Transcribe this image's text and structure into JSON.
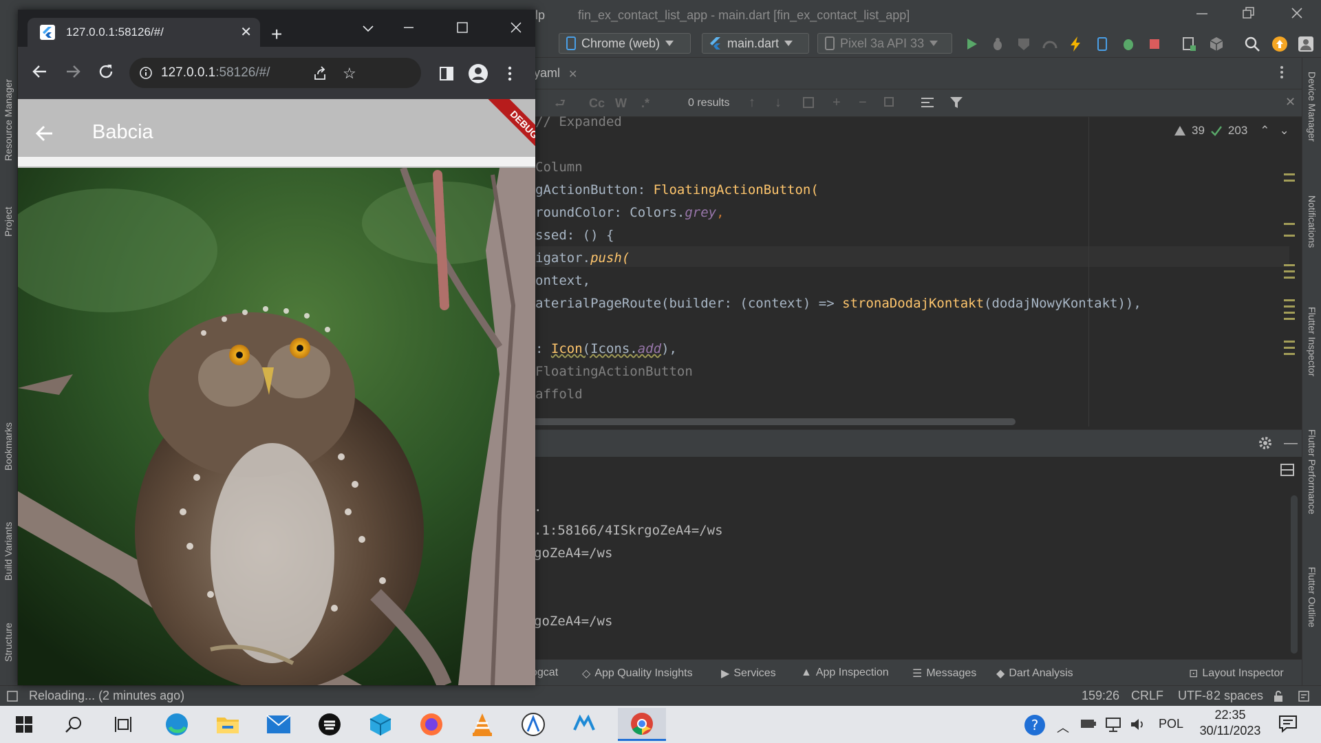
{
  "ide": {
    "title_fragment": "lp",
    "title": "fin_ex_contact_list_app - main.dart [fin_ex_contact_list_app]",
    "toolbar": {
      "device_target": "Chrome (web)",
      "run_config": "main.dart",
      "emulator": "Pixel 3a API 33"
    },
    "left_panels": [
      "Resource Manager",
      "Project",
      "Bookmarks",
      "Build Variants",
      "Structure"
    ],
    "right_panels": [
      "Device Manager",
      "Notifications",
      "Flutter Inspector",
      "Flutter Performance",
      "Flutter Outline"
    ],
    "editor_tab": "yaml",
    "find": {
      "case_label": "Cc",
      "word_label": "W",
      "regex_label": ".*",
      "results": "0 results"
    },
    "inspection": {
      "warnings": "39",
      "weak_warnings": "203"
    },
    "code": {
      "l1": "// Expanded",
      "l2": "Column",
      "l3a": "gActionButton: ",
      "l3b": "FloatingActionButton(",
      "l4a": "roundColor: Colors.",
      "l4b": "grey",
      "l4c": ",",
      "l5": "ssed: () {",
      "l6a": "igator.",
      "l6b": "push(",
      "l7": "ontext,",
      "l8a": "aterialPageRoute(builder: (context) => ",
      "l8b": "stronaDodajKontakt",
      "l8c": "(dodajNowyKontakt)),",
      "l9a": ": ",
      "l9b": "Icon",
      "l9c": "(Icons.",
      "l9d": "add",
      "l9e": "),",
      "l10": "FloatingActionButton",
      "l11": "affold"
    },
    "console": {
      "c1": ".",
      "c2": ".1:58166/4ISkrgoZeA4=/ws",
      "c3": "goZeA4=/ws",
      "c4": "goZeA4=/ws"
    },
    "tool_tabs": [
      "ogcat",
      "App Quality Insights",
      "Services",
      "App Inspection",
      "Messages",
      "Dart Analysis",
      "Layout Inspector"
    ],
    "status": {
      "message": "Reloading... (2 minutes ago)",
      "position": "159:26",
      "line_sep": "CRLF",
      "encoding": "UTF-8",
      "indent": "2 spaces"
    }
  },
  "chrome": {
    "tab_title": "127.0.0.1:58126/#/",
    "url_host": "127.0.0.1",
    "url_rest": ":58126/#/"
  },
  "app": {
    "title": "Babcia",
    "debug_banner": "DEBUG",
    "colors": {
      "app_bar": "#bdbdbd",
      "debug_banner": "#b71c1c"
    }
  },
  "taskbar": {
    "language": "POL",
    "time": "22:35",
    "date": "30/11/2023"
  }
}
